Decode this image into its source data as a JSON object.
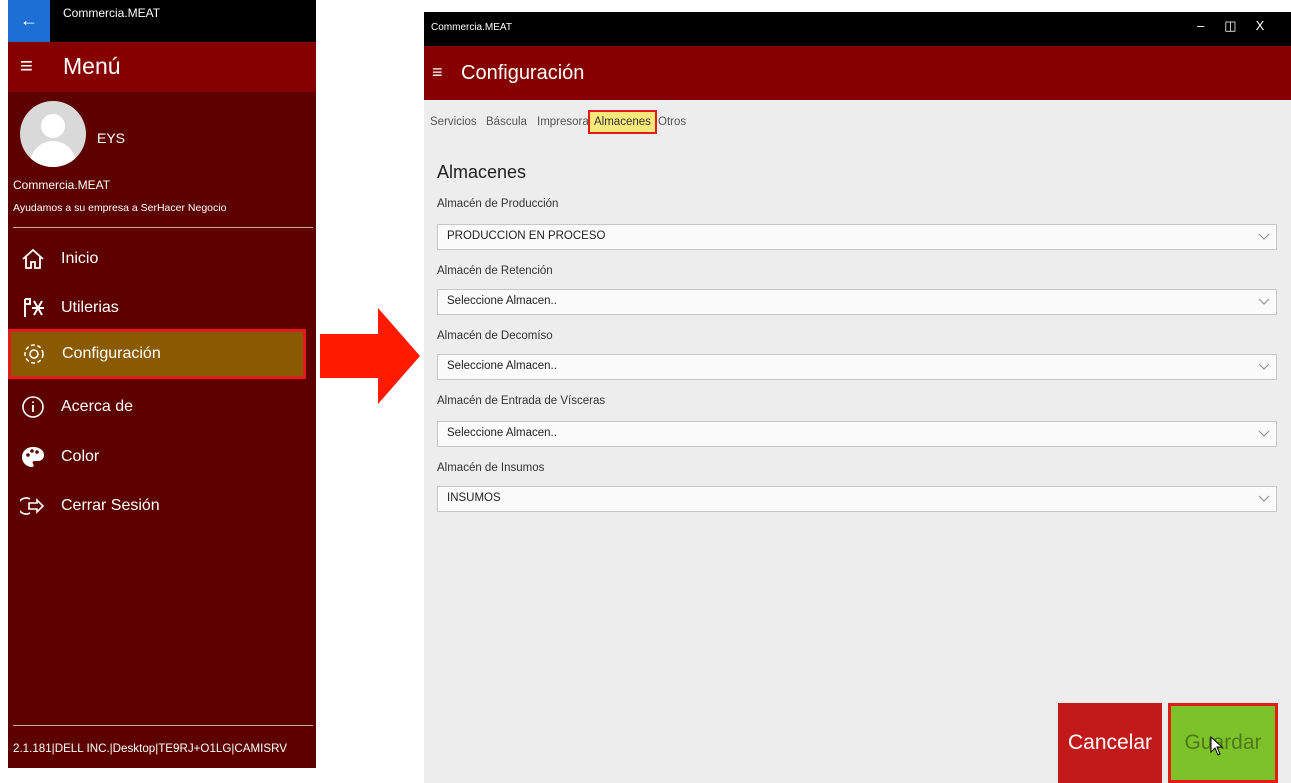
{
  "left": {
    "app_title": "Commercia.MEAT",
    "menu_title": "Menú",
    "user_name": "EYS",
    "company": "Commercia.MEAT",
    "slogan": "Ayudamos a su empresa a SerHacer Negocio",
    "items": [
      {
        "label": "Inicio",
        "icon": "home-icon"
      },
      {
        "label": "Utilerias",
        "icon": "tools-icon"
      },
      {
        "label": "Configuración",
        "icon": "gear-icon",
        "active": true
      },
      {
        "label": "Acerca de",
        "icon": "info-icon"
      },
      {
        "label": "Color",
        "icon": "palette-icon"
      },
      {
        "label": "Cerrar Sesión",
        "icon": "logout-icon"
      }
    ],
    "footer": "2.1.181|DELL INC.|Desktop|TE9RJ+O1LG|CAMISRV"
  },
  "window": {
    "app_title": "Commercia.MEAT",
    "controls": {
      "minimize": "–",
      "restore": "◫",
      "close": "X"
    },
    "page_title": "Configuración",
    "tabs": [
      "Servicios",
      "Báscula",
      "Impresora",
      "Almacenes",
      "Otros"
    ],
    "active_tab": "Almacenes",
    "section_title": "Almacenes",
    "fields": [
      {
        "label": "Almacén de Producción",
        "value": "PRODUCCION EN PROCESO"
      },
      {
        "label": "Almacén de Retención",
        "value": "Seleccione Almacen.."
      },
      {
        "label": "Almacén de Decomíso",
        "value": "Seleccione Almacen.."
      },
      {
        "label": "Almacén de Entrada de Vísceras",
        "value": "Seleccione Almacen.."
      },
      {
        "label": "Almacén de Insumos",
        "value": "INSUMOS"
      }
    ],
    "cancel_label": "Cancelar",
    "save_label": "Guardar"
  },
  "colors": {
    "menu_bg": "#5c0000",
    "header_bg": "#860000",
    "active_item": "#8a5a00",
    "highlight_border": "#e41b1b",
    "arrow": "#ff1a00",
    "cancel": "#c21a1a",
    "save": "#7ec22a",
    "back_button": "#1e6fd3"
  }
}
